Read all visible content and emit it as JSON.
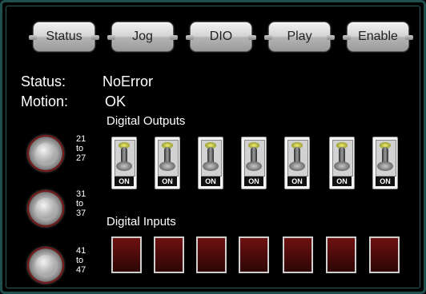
{
  "toolbar": {
    "buttons": [
      "Status",
      "Jog",
      "DIO",
      "Play",
      "Enable"
    ]
  },
  "status": {
    "status_label": "Status:",
    "status_value": "NoError",
    "motion_label": "Motion:",
    "motion_value": "OK"
  },
  "outputs": {
    "title": "Digital Outputs",
    "switch_label": "ON",
    "count": 7
  },
  "inputs": {
    "title": "Digital Inputs",
    "count": 7
  },
  "knobs": [
    {
      "from": "21",
      "to_word": "to",
      "to": "27"
    },
    {
      "from": "31",
      "to_word": "to",
      "to": "37"
    },
    {
      "from": "41",
      "to_word": "to",
      "to": "47"
    }
  ],
  "colors": {
    "frame": "#1f4f4f",
    "input_box": "#5a0b0b",
    "knob_ring": "#b52020",
    "led": "#e0e060"
  }
}
